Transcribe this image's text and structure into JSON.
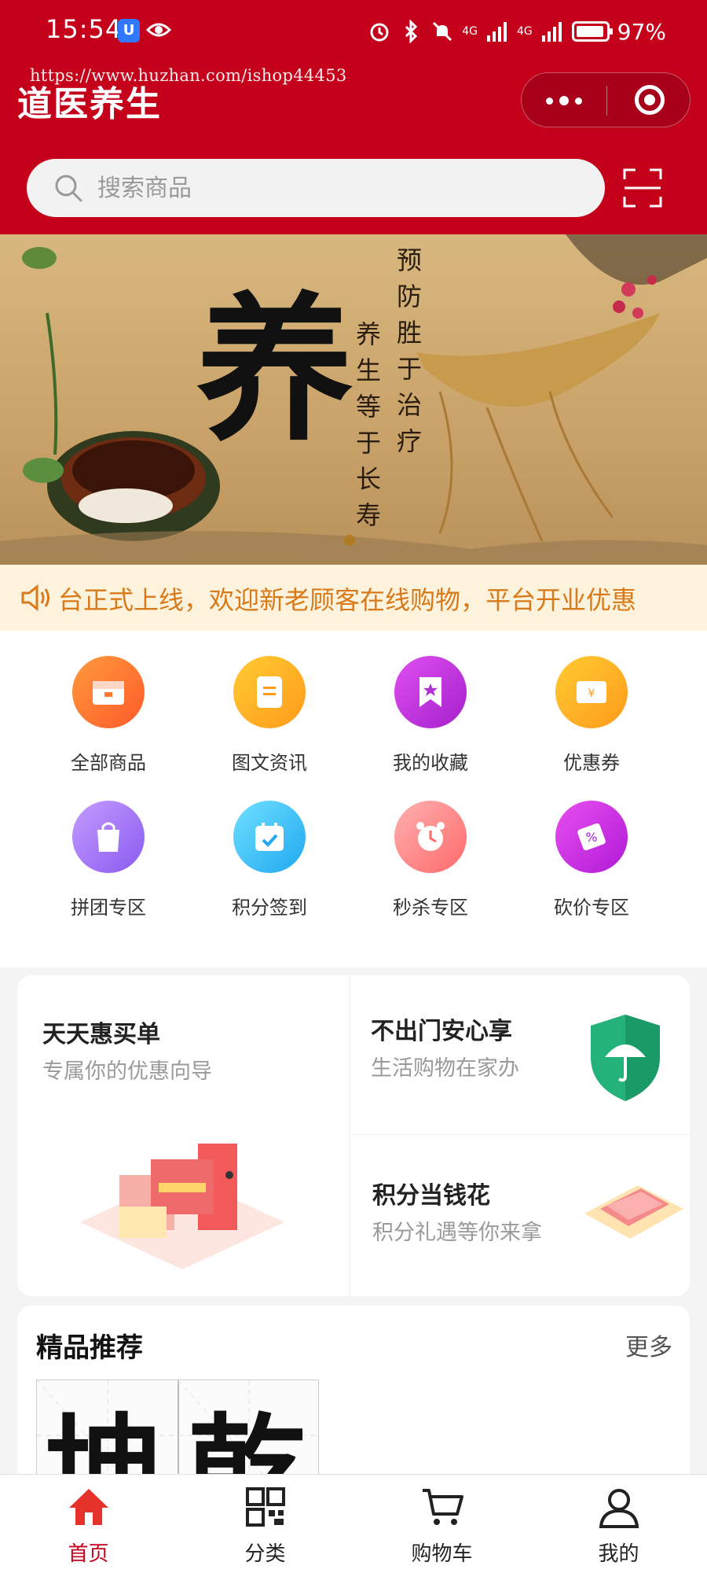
{
  "status_bar": {
    "time": "15:54",
    "network_1": "4G",
    "network_2": "4G",
    "battery": "97%"
  },
  "watermark": "https://www.huzhan.com/ishop44453",
  "header": {
    "title": "道医养生"
  },
  "search": {
    "placeholder": "搜索商品"
  },
  "banner": {
    "big_char": "养",
    "line1": "预防胜于治疗",
    "line2": "养生等于长寿"
  },
  "notice": {
    "text": "台正式上线，欢迎新老顾客在线购物，平台开业优惠"
  },
  "menu": [
    {
      "label": "全部商品",
      "icon": "store-icon",
      "color": "#ff7a2f"
    },
    {
      "label": "图文资讯",
      "icon": "article-icon",
      "color": "#ffb21a"
    },
    {
      "label": "我的收藏",
      "icon": "bookmark-icon",
      "color": "#c63be0"
    },
    {
      "label": "优惠券",
      "icon": "coupon-icon",
      "color": "#ffaa1a"
    },
    {
      "label": "拼团专区",
      "icon": "bag-icon",
      "color": "#a774f2"
    },
    {
      "label": "积分签到",
      "icon": "calendar-icon",
      "color": "#3ec3f6"
    },
    {
      "label": "秒杀专区",
      "icon": "alarm-clock-icon",
      "color": "#ff8a8a"
    },
    {
      "label": "砍价专区",
      "icon": "discount-ticket-icon",
      "color": "#c42be0"
    }
  ],
  "promo": {
    "left_title": "天天惠买单",
    "left_sub": "专属你的优惠向导",
    "tr_title": "不出门安心享",
    "tr_sub": "生活购物在家办",
    "br_title": "积分当钱花",
    "br_sub": "积分礼遇等你来拿"
  },
  "recommend": {
    "title": "精品推荐",
    "more": "更多",
    "chars": [
      "坤",
      "乾"
    ]
  },
  "tabbar": [
    {
      "label": "首页",
      "icon": "home-icon"
    },
    {
      "label": "分类",
      "icon": "grid-category-icon"
    },
    {
      "label": "购物车",
      "icon": "cart-icon"
    },
    {
      "label": "我的",
      "icon": "user-icon"
    }
  ],
  "colors": {
    "brand": "#c4001a",
    "notice_text": "#d87a1a"
  }
}
